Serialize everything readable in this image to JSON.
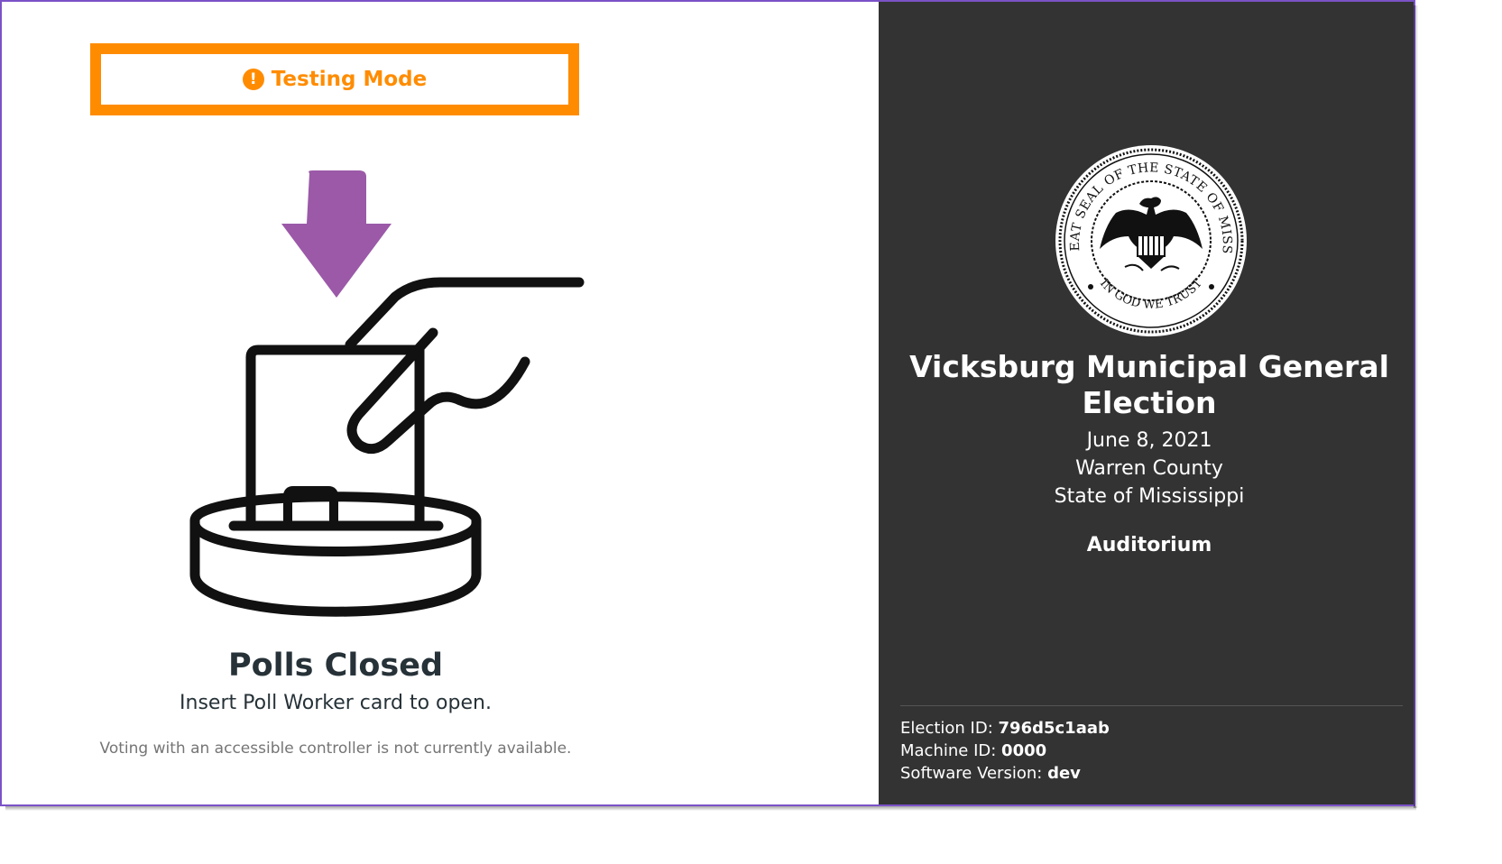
{
  "testing_banner": {
    "label": "Testing Mode",
    "icon": "alert-circle-icon",
    "color": "#ff8c00"
  },
  "status": {
    "title": "Polls Closed",
    "instruction": "Insert Poll Worker card to open.",
    "accessibility_note": "Voting with an accessible controller is not currently available."
  },
  "illustration": {
    "arrow_color": "#9b59a8",
    "icon": "insert-card-icon"
  },
  "sidebar": {
    "background": "#333333",
    "seal_outer_text": "THE GREAT SEAL OF THE STATE OF MISSISSIPPI",
    "seal_motto": "IN GOD WE TRUST",
    "election_title": "Vicksburg Municipal General Election",
    "election_date": "June 8, 2021",
    "county": "Warren County",
    "state": "State of Mississippi",
    "precinct": "Auditorium",
    "election_id_label": "Election ID:",
    "election_id": "796d5c1aab",
    "machine_id_label": "Machine ID:",
    "machine_id": "0000",
    "software_version_label": "Software Version:",
    "software_version": "dev"
  }
}
